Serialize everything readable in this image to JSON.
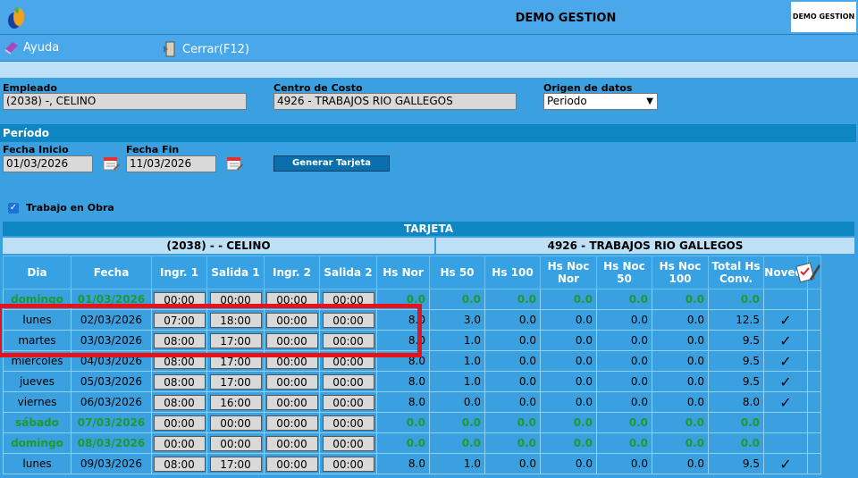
{
  "header": {
    "title": "DEMO GESTION",
    "brand": "DEMO GESTION"
  },
  "menu": [
    {
      "label": "Ayuda",
      "icon": "help-book-icon"
    },
    {
      "label": "Cerrar(F12)",
      "icon": "exit-icon"
    }
  ],
  "filters": {
    "empleado": {
      "label": "Empleado",
      "value": "(2038) -,  CELINO"
    },
    "centro": {
      "label": "Centro de Costo",
      "value": "4926 - TRABAJOS RIO GALLEGOS"
    },
    "origen": {
      "label": "Origen de datos",
      "value": "Periodo"
    }
  },
  "periodo": {
    "title": "Período",
    "inicio": {
      "label": "Fecha Inicio",
      "value": "01/03/2026"
    },
    "fin": {
      "label": "Fecha Fin",
      "value": "11/03/2026"
    },
    "generar": "Generar Tarjeta"
  },
  "trabajo_obra": {
    "label": "Trabajo en Obra",
    "checked": true
  },
  "tarjeta": {
    "title": "TARJETA",
    "empleado": "(2038) - - CELINO",
    "centro": "4926 - TRABAJOS RIO GALLEGOS",
    "columns": [
      "Dia",
      "Fecha",
      "Ingr. 1",
      "Salida 1",
      "Ingr. 2",
      "Salida 2",
      "Hs Nor",
      "Hs 50",
      "Hs 100",
      "Hs Noc Nor",
      "Hs Noc 50",
      "Hs Noc 100",
      "Total Hs Conv.",
      "Noved."
    ],
    "rows": [
      {
        "dia": "domingo",
        "fecha": "01/03/2026",
        "in1": "00:00",
        "out1": "00:00",
        "in2": "00:00",
        "out2": "00:00",
        "nor": "0.0",
        "h50": "0.0",
        "h100": "0.0",
        "nn": "0.0",
        "n50": "0.0",
        "n100": "0.0",
        "total": "0.0",
        "nov": "",
        "weekend": true
      },
      {
        "dia": "lunes",
        "fecha": "02/03/2026",
        "in1": "07:00",
        "out1": "18:00",
        "in2": "00:00",
        "out2": "00:00",
        "nor": "8.0",
        "h50": "3.0",
        "h100": "0.0",
        "nn": "0.0",
        "n50": "0.0",
        "n100": "0.0",
        "total": "12.5",
        "nov": "✓",
        "weekend": false
      },
      {
        "dia": "martes",
        "fecha": "03/03/2026",
        "in1": "08:00",
        "out1": "17:00",
        "in2": "00:00",
        "out2": "00:00",
        "nor": "8.0",
        "h50": "1.0",
        "h100": "0.0",
        "nn": "0.0",
        "n50": "0.0",
        "n100": "0.0",
        "total": "9.5",
        "nov": "✓",
        "weekend": false
      },
      {
        "dia": "miércoles",
        "fecha": "04/03/2026",
        "in1": "08:00",
        "out1": "17:00",
        "in2": "00:00",
        "out2": "00:00",
        "nor": "8.0",
        "h50": "1.0",
        "h100": "0.0",
        "nn": "0.0",
        "n50": "0.0",
        "n100": "0.0",
        "total": "9.5",
        "nov": "✓",
        "weekend": false
      },
      {
        "dia": "jueves",
        "fecha": "05/03/2026",
        "in1": "08:00",
        "out1": "17:00",
        "in2": "00:00",
        "out2": "00:00",
        "nor": "8.0",
        "h50": "1.0",
        "h100": "0.0",
        "nn": "0.0",
        "n50": "0.0",
        "n100": "0.0",
        "total": "9.5",
        "nov": "✓",
        "weekend": false
      },
      {
        "dia": "viernes",
        "fecha": "06/03/2026",
        "in1": "08:00",
        "out1": "16:00",
        "in2": "00:00",
        "out2": "00:00",
        "nor": "8.0",
        "h50": "0.0",
        "h100": "0.0",
        "nn": "0.0",
        "n50": "0.0",
        "n100": "0.0",
        "total": "8.0",
        "nov": "✓",
        "weekend": false
      },
      {
        "dia": "sábado",
        "fecha": "07/03/2026",
        "in1": "00:00",
        "out1": "00:00",
        "in2": "00:00",
        "out2": "00:00",
        "nor": "0.0",
        "h50": "0.0",
        "h100": "0.0",
        "nn": "0.0",
        "n50": "0.0",
        "n100": "0.0",
        "total": "0.0",
        "nov": "",
        "weekend": true
      },
      {
        "dia": "domingo",
        "fecha": "08/03/2026",
        "in1": "00:00",
        "out1": "00:00",
        "in2": "00:00",
        "out2": "00:00",
        "nor": "0.0",
        "h50": "0.0",
        "h100": "0.0",
        "nn": "0.0",
        "n50": "0.0",
        "n100": "0.0",
        "total": "0.0",
        "nov": "",
        "weekend": true
      },
      {
        "dia": "lunes",
        "fecha": "09/03/2026",
        "in1": "08:00",
        "out1": "17:00",
        "in2": "00:00",
        "out2": "00:00",
        "nor": "8.0",
        "h50": "1.0",
        "h100": "0.0",
        "nn": "0.0",
        "n50": "0.0",
        "n100": "0.0",
        "total": "9.5",
        "nov": "✓",
        "weekend": false
      }
    ]
  },
  "colors": {
    "accent": "#0e86c2",
    "background": "#3aa0e0",
    "weekend": "#1d9a2e",
    "highlight": "#e8121a"
  }
}
